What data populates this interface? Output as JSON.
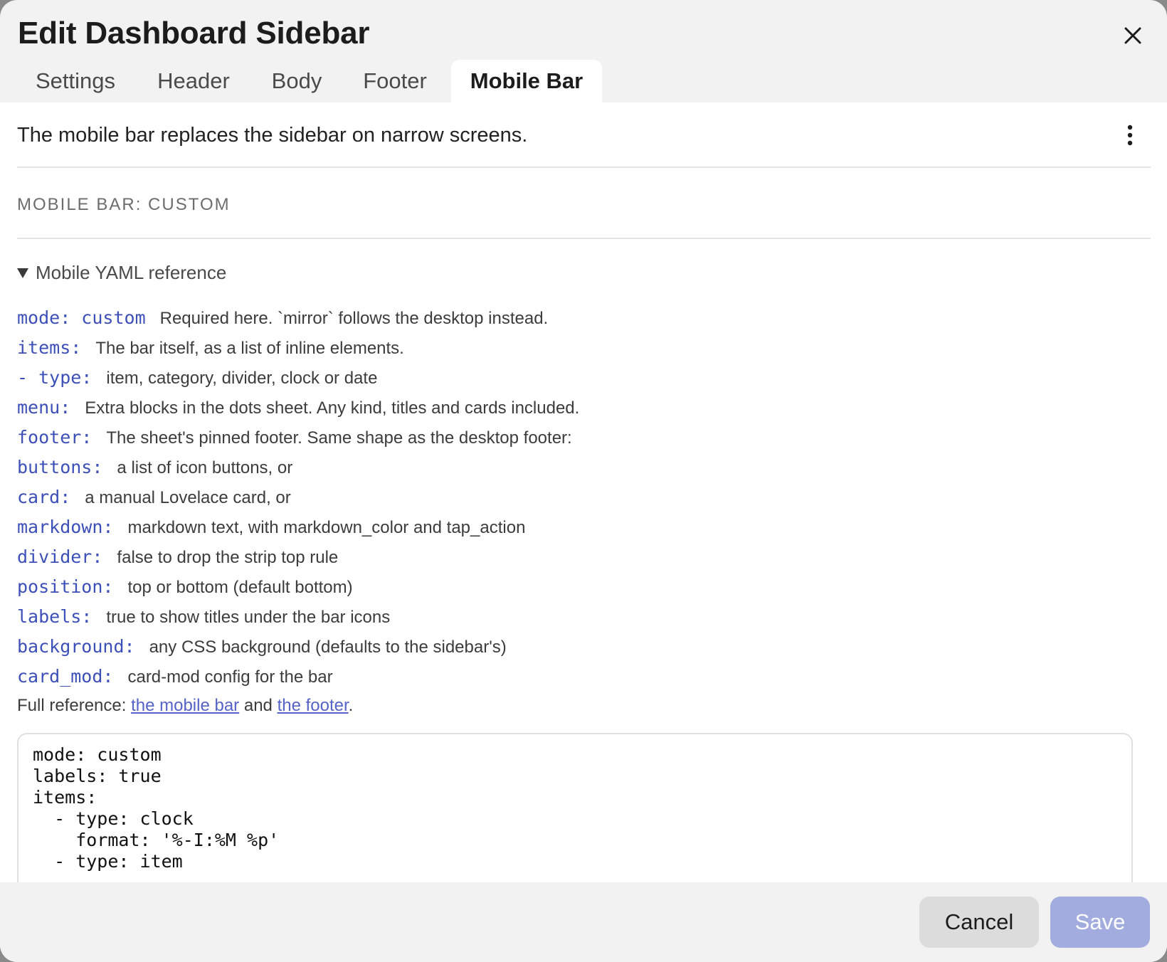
{
  "dialog": {
    "title": "Edit Dashboard Sidebar",
    "close_icon": "close-icon"
  },
  "tabs": [
    {
      "label": "Settings",
      "active": false
    },
    {
      "label": "Header",
      "active": false
    },
    {
      "label": "Body",
      "active": false
    },
    {
      "label": "Footer",
      "active": false
    },
    {
      "label": "Mobile Bar",
      "active": true
    }
  ],
  "content": {
    "description": "The mobile bar replaces the sidebar on narrow screens.",
    "menu_icon": "more-vertical-icon",
    "section_label": "MOBILE BAR: CUSTOM",
    "disclosure_label": "Mobile YAML reference",
    "reference": [
      {
        "key": "mode: custom",
        "text": "Required here. `mirror` follows the desktop instead."
      },
      {
        "key": "items:",
        "text": "The bar itself, as a list of inline elements."
      },
      {
        "key": "- type:",
        "text": "item, category, divider, clock or date"
      },
      {
        "key": "menu:",
        "text": "Extra blocks in the dots sheet. Any kind, titles and cards included."
      },
      {
        "key": "footer:",
        "text": "The sheet's pinned footer. Same shape as the desktop footer:"
      },
      {
        "key": "buttons:",
        "text": "a list of icon buttons, or"
      },
      {
        "key": "card:",
        "text": "a manual Lovelace card, or"
      },
      {
        "key": "markdown:",
        "text": "markdown text, with markdown_color and tap_action"
      },
      {
        "key": "divider:",
        "text": "false to drop the strip top rule"
      },
      {
        "key": "position:",
        "text": "top or bottom (default bottom)"
      },
      {
        "key": "labels:",
        "text": "true to show titles under the bar icons"
      },
      {
        "key": "background:",
        "text": "any CSS background (defaults to the sidebar's)"
      },
      {
        "key": "card_mod:",
        "text": "card-mod config for the bar"
      }
    ],
    "full_ref_prefix": "Full reference: ",
    "full_ref_link1": "the mobile bar",
    "full_ref_and": " and ",
    "full_ref_link2": "the footer",
    "full_ref_suffix": ".",
    "code": "mode: custom\nlabels: true\nitems:\n  - type: clock\n    format: '%-I:%M %p'\n  - type: item"
  },
  "footer": {
    "cancel_label": "Cancel",
    "save_label": "Save"
  },
  "colors": {
    "yaml_key": "#3d4fb8",
    "link": "#5563c8",
    "save_disabled": "#a3acdf"
  }
}
